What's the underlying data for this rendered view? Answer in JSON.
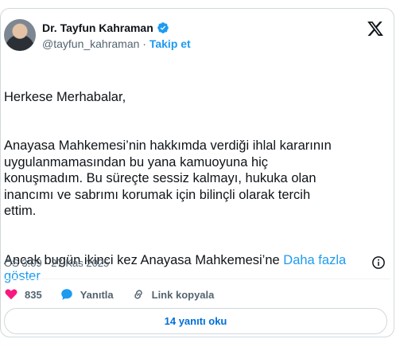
{
  "author": {
    "name": "Dr. Tayfun Kahraman",
    "handle": "@tayfun_kahraman",
    "separator": "·",
    "follow_label": "Takip et"
  },
  "tweet": {
    "paragraphs": [
      "Herkese Merhabalar,",
      "Anayasa Mahkemesi’nin hakkımda verdiği ihlal kararının\nuygulanmamasından bu yana kamuoyuna hiç\nkonuşmadım. Bu süreçte sessiz kalmayı, hukuka olan\ninancımı ve sabrımı korumak için bilinçli olarak tercih\nettim."
    ],
    "last_paragraph": "Ancak bugün ikinci kez Anayasa Mahkemesi’ne ",
    "show_more_label": "Daha fazla\ngöster",
    "timestamp": "ÖS 3:09 · 27 Kas 2025"
  },
  "actions": {
    "like_count": "835",
    "reply_label": "Yanıtla",
    "copy_link_label": "Link kopyala"
  },
  "replies_button_label": "14 yanıtı oku",
  "colors": {
    "accent": "#1d9bf0",
    "like": "#f91880",
    "text": "#0f1419",
    "muted": "#536471"
  },
  "icons": [
    "verified-icon",
    "x-logo-icon",
    "info-icon",
    "heart-icon",
    "reply-icon",
    "link-icon"
  ]
}
